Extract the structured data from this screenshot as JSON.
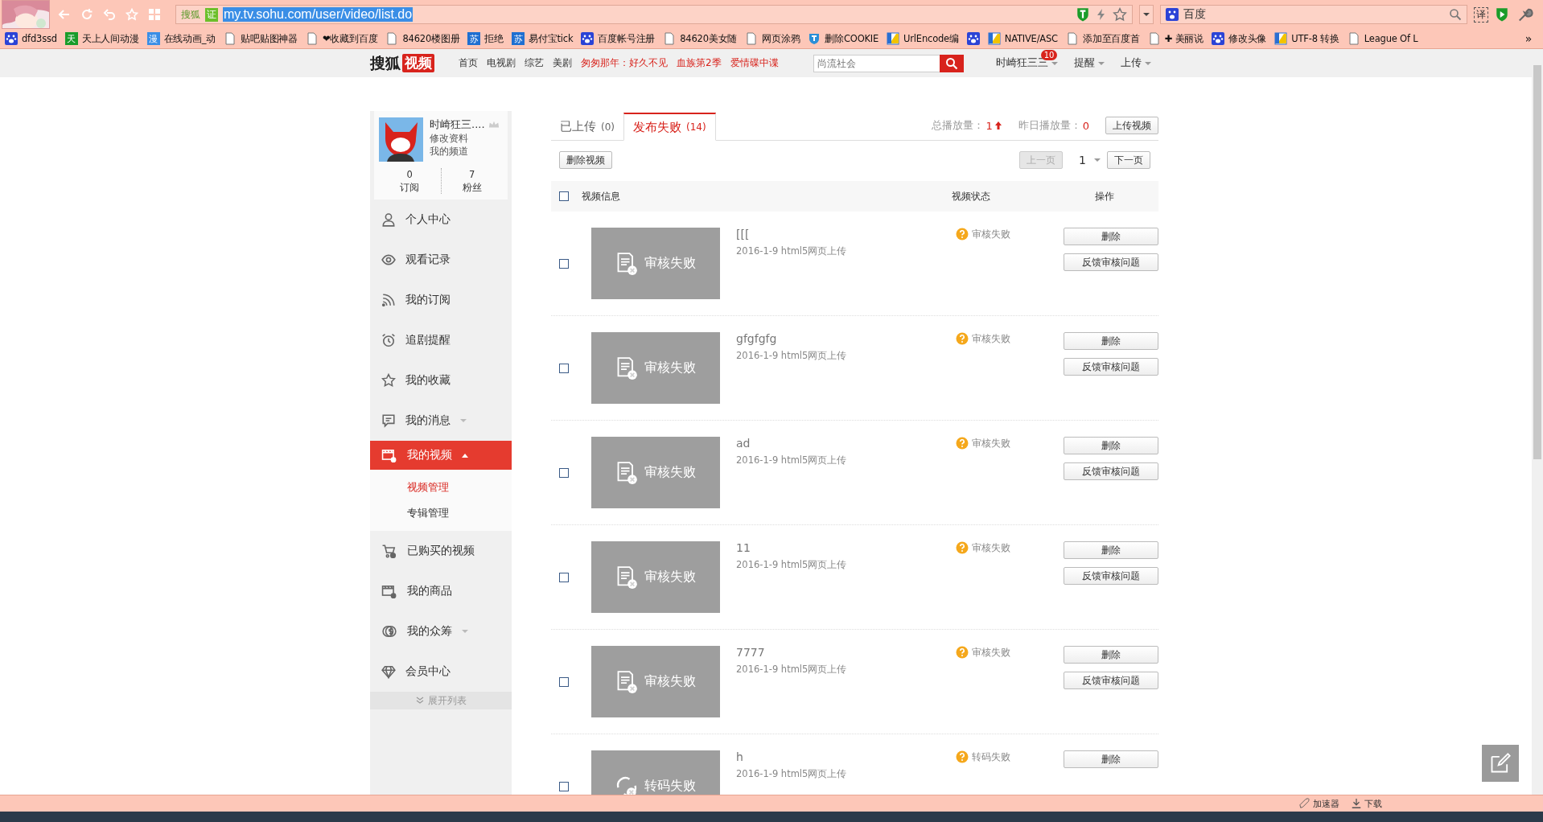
{
  "browser": {
    "site_label": "搜狐",
    "cert_badge": "证",
    "url": "my.tv.sohu.com/user/video/list.do",
    "search_engine": "百度",
    "translate": "译"
  },
  "bookmarks": [
    {
      "kind": "paw",
      "label": "dfd3ssd"
    },
    {
      "kind": "glyph",
      "glyph": "天",
      "color": "#1a9c2a",
      "label": "天上人间动漫"
    },
    {
      "kind": "glyph",
      "glyph": "漫",
      "color": "#3a8ee6",
      "label": "在线动画_动"
    },
    {
      "kind": "page",
      "label": "贴吧贴图神器"
    },
    {
      "kind": "page",
      "label": "❤收藏到百度"
    },
    {
      "kind": "page",
      "label": "84620楼图册"
    },
    {
      "kind": "glyph",
      "glyph": "苏",
      "color": "#1f6fd1",
      "label": "拒绝"
    },
    {
      "kind": "glyph",
      "glyph": "苏",
      "color": "#1f6fd1",
      "label": "易付宝tick"
    },
    {
      "kind": "paw",
      "label": "百度帐号注册"
    },
    {
      "kind": "page",
      "label": "84620美女随"
    },
    {
      "kind": "page",
      "label": "网页涂鸦"
    },
    {
      "kind": "shield",
      "label": "删除COOKIE"
    },
    {
      "kind": "split",
      "label": "UrlEncode编"
    },
    {
      "kind": "paw"
    },
    {
      "kind": "split",
      "label": "NATIVE/ASC"
    },
    {
      "kind": "page",
      "label": "添加至百度首"
    },
    {
      "kind": "page",
      "label": "✚ 美丽说"
    },
    {
      "kind": "paw",
      "label": "修改头像"
    },
    {
      "kind": "split",
      "label": "UTF-8 转换"
    },
    {
      "kind": "page",
      "label": "League Of L"
    }
  ],
  "bookmarks_more": "»",
  "site_header": {
    "logo_text": "搜狐",
    "logo_badge": "视频",
    "nav": [
      {
        "label": "首页",
        "highlight": false
      },
      {
        "label": "电视剧",
        "highlight": false
      },
      {
        "label": "综艺",
        "highlight": false
      },
      {
        "label": "美剧",
        "highlight": false
      },
      {
        "label": "匆匆那年：好久不见",
        "highlight": true
      },
      {
        "label": "血族第2季",
        "highlight": true
      },
      {
        "label": "爱情碟中谍",
        "highlight": true
      }
    ],
    "search": {
      "placeholder": "尚流社会"
    },
    "user": {
      "name": "时崎狂三三",
      "badge": "10"
    },
    "menus": [
      "提醒",
      "上传"
    ]
  },
  "sidebar": {
    "profile": {
      "name": "时崎狂三....",
      "links": [
        "修改资料",
        "我的频道"
      ],
      "stats": [
        {
          "value": "0",
          "label": "订阅"
        },
        {
          "value": "7",
          "label": "粉丝"
        }
      ]
    },
    "items": [
      {
        "kind": "person",
        "label": "个人中心",
        "selected": false
      },
      {
        "kind": "eye",
        "label": "观看记录",
        "selected": false
      },
      {
        "kind": "rss",
        "label": "我的订阅",
        "selected": false
      },
      {
        "kind": "alarm",
        "label": "追剧提醒",
        "selected": false
      },
      {
        "kind": "star",
        "label": "我的收藏",
        "selected": false
      },
      {
        "kind": "chat",
        "label": "我的消息",
        "selected": false,
        "expanded": false
      },
      {
        "kind": "film",
        "label": "我的视频",
        "selected": true,
        "expanded": true,
        "children": [
          {
            "label": "视频管理",
            "selected": true
          },
          {
            "label": "专辑管理",
            "selected": false
          }
        ]
      },
      {
        "kind": "cart",
        "label": "已购买的视频",
        "selected": false
      },
      {
        "kind": "film",
        "label": "我的商品",
        "selected": false
      },
      {
        "kind": "coin",
        "label": "我的众筹",
        "selected": false,
        "expanded": false
      },
      {
        "kind": "diamond",
        "label": "会员中心",
        "selected": false
      }
    ],
    "footer": "展开列表"
  },
  "content": {
    "tabs": [
      {
        "label": "已上传",
        "count": "(0)",
        "selected": false
      },
      {
        "label": "发布失败",
        "count": "(14)",
        "selected": true
      }
    ],
    "stats": [
      {
        "label": "总播放量：",
        "value": "1",
        "trend_up": true
      },
      {
        "label": "昨日播放量：",
        "value": "0",
        "trend_up": false
      }
    ],
    "upload_button": "上传视频",
    "delete_button": "删除视频",
    "pager": {
      "prev": "上一页",
      "prev_disabled": true,
      "page": "1",
      "next": "下一页"
    },
    "table": {
      "select_all": {
        "checked": false
      },
      "columns": [
        "视频信息",
        "视频状态",
        "操作"
      ],
      "rows": [
        {
          "checked": false,
          "kind": "audit",
          "thumb_label": "审核失败",
          "title": "[[[",
          "meta": "2016-1-9 html5网页上传",
          "status": "审核失败",
          "actions": [
            "删除",
            "反馈审核问题"
          ]
        },
        {
          "checked": false,
          "kind": "audit",
          "thumb_label": "审核失败",
          "title": "gfgfgfg",
          "meta": "2016-1-9 html5网页上传",
          "status": "审核失败",
          "actions": [
            "删除",
            "反馈审核问题"
          ]
        },
        {
          "checked": false,
          "kind": "audit",
          "thumb_label": "审核失败",
          "title": "ad",
          "meta": "2016-1-9 html5网页上传",
          "status": "审核失败",
          "actions": [
            "删除",
            "反馈审核问题"
          ]
        },
        {
          "checked": false,
          "kind": "audit",
          "thumb_label": "审核失败",
          "title": "11",
          "meta": "2016-1-9 html5网页上传",
          "status": "审核失败",
          "actions": [
            "删除",
            "反馈审核问题"
          ]
        },
        {
          "checked": false,
          "kind": "audit",
          "thumb_label": "审核失败",
          "title": "7777",
          "meta": "2016-1-9 html5网页上传",
          "status": "审核失败",
          "actions": [
            "删除",
            "反馈审核问题"
          ]
        },
        {
          "checked": false,
          "kind": "transcode",
          "thumb_label": "转码失败",
          "title": "h",
          "meta": "2016-1-9 html5网页上传",
          "status": "转码失败",
          "actions": [
            "删除"
          ]
        }
      ]
    }
  },
  "status_bar": {
    "items": [
      "加速器",
      "下载"
    ]
  }
}
